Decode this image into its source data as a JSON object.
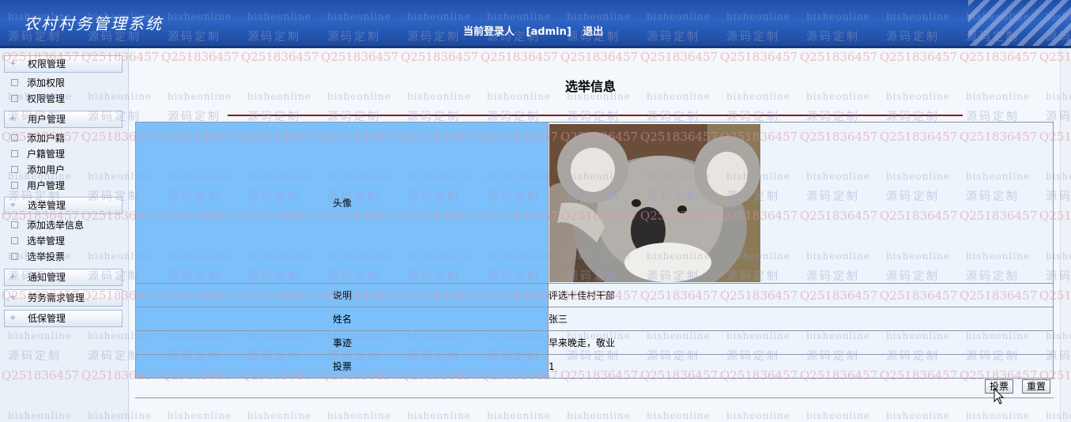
{
  "header": {
    "app_title": "农村村务管理系统",
    "login_label": "当前登录人",
    "user": "[admin]",
    "logout": "退出"
  },
  "sidebar": {
    "groups": [
      {
        "label": "权限管理",
        "items": [
          "添加权限",
          "权限管理"
        ]
      },
      {
        "label": "用户管理",
        "items": [
          "添加户籍",
          "户籍管理",
          "添加用户",
          "用户管理"
        ]
      },
      {
        "label": "选举管理",
        "items": [
          "添加选举信息",
          "选举管理",
          "选举投票"
        ]
      },
      {
        "label": "通知管理",
        "items": []
      },
      {
        "label": "劳务需求管理",
        "items": []
      },
      {
        "label": "低保管理",
        "items": []
      }
    ]
  },
  "main": {
    "title": "选举信息",
    "rows": [
      {
        "label": "头像",
        "value": ""
      },
      {
        "label": "说明",
        "value": "评选十佳村干部"
      },
      {
        "label": "姓名",
        "value": "张三"
      },
      {
        "label": "事迹",
        "value": "早来晚走，敬业"
      },
      {
        "label": "投票",
        "value": "1"
      }
    ],
    "vote_button": "投票",
    "reset_button": "重置"
  },
  "watermark": {
    "qq": "Q251836457",
    "site": "bisheonline",
    "custom": "源码定制"
  },
  "colors": {
    "header": "#2e64c4",
    "label_cell": "#7cc0fb",
    "title_rule": "#8b1a1a"
  }
}
